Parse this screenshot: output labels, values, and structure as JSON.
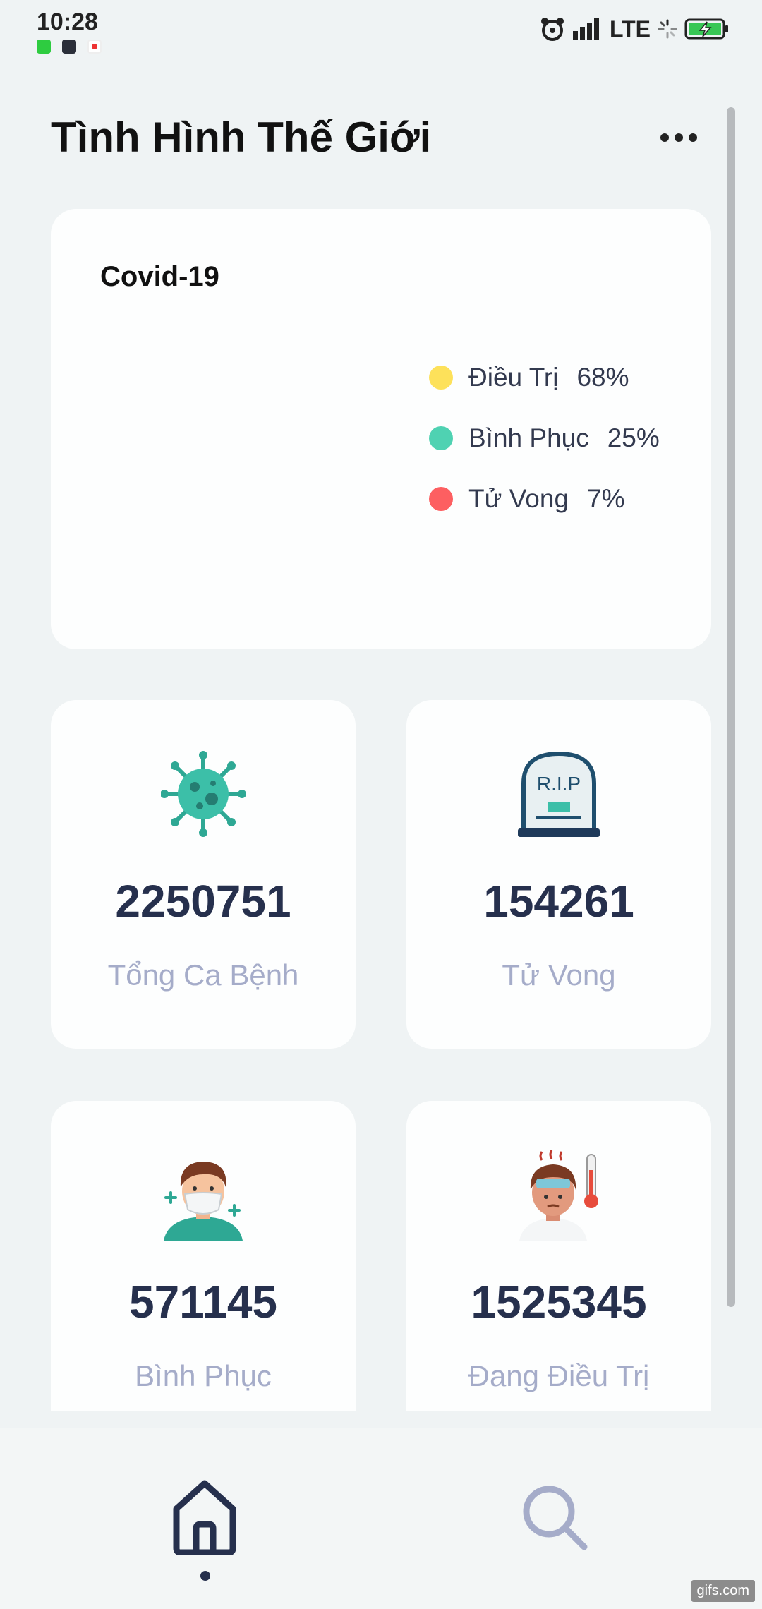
{
  "status_bar": {
    "time": "10:28",
    "network": "LTE",
    "icons": [
      "facetime-icon",
      "app-icon",
      "heart-icon",
      "alarm-icon",
      "signal-icon",
      "loading-icon",
      "battery-charging-icon"
    ]
  },
  "header": {
    "title": "Tình Hình Thế Giới",
    "menu_icon": "more-horizontal-icon"
  },
  "summary": {
    "title": "Covid-19",
    "legend": [
      {
        "name": "Điều Trị",
        "percent": "68%",
        "color": "#fde15a"
      },
      {
        "name": "Bình Phục",
        "percent": "25%",
        "color": "#4fd2b2"
      },
      {
        "name": "Tử Vong",
        "percent": "7%",
        "color": "#fd5f61"
      }
    ]
  },
  "stats": [
    {
      "value": "2250751",
      "label": "Tổng Ca Bệnh",
      "icon": "virus-icon"
    },
    {
      "value": "154261",
      "label": "Tử Vong",
      "icon": "gravestone-icon",
      "icon_text": "R.I.P"
    },
    {
      "value": "571145",
      "label": "Bình Phục",
      "icon": "masked-person-icon"
    },
    {
      "value": "1525345",
      "label": "Đang Điều Trị",
      "icon": "sick-person-icon"
    }
  ],
  "bottom_nav": {
    "items": [
      {
        "name": "home",
        "icon": "home-icon",
        "active": true
      },
      {
        "name": "search",
        "icon": "search-icon",
        "active": false
      }
    ]
  },
  "watermark": "gifs.com",
  "colors": {
    "background": "#eff3f4",
    "card": "#fdfefe",
    "value_text": "#26304d",
    "label_text": "#a5acc9"
  }
}
